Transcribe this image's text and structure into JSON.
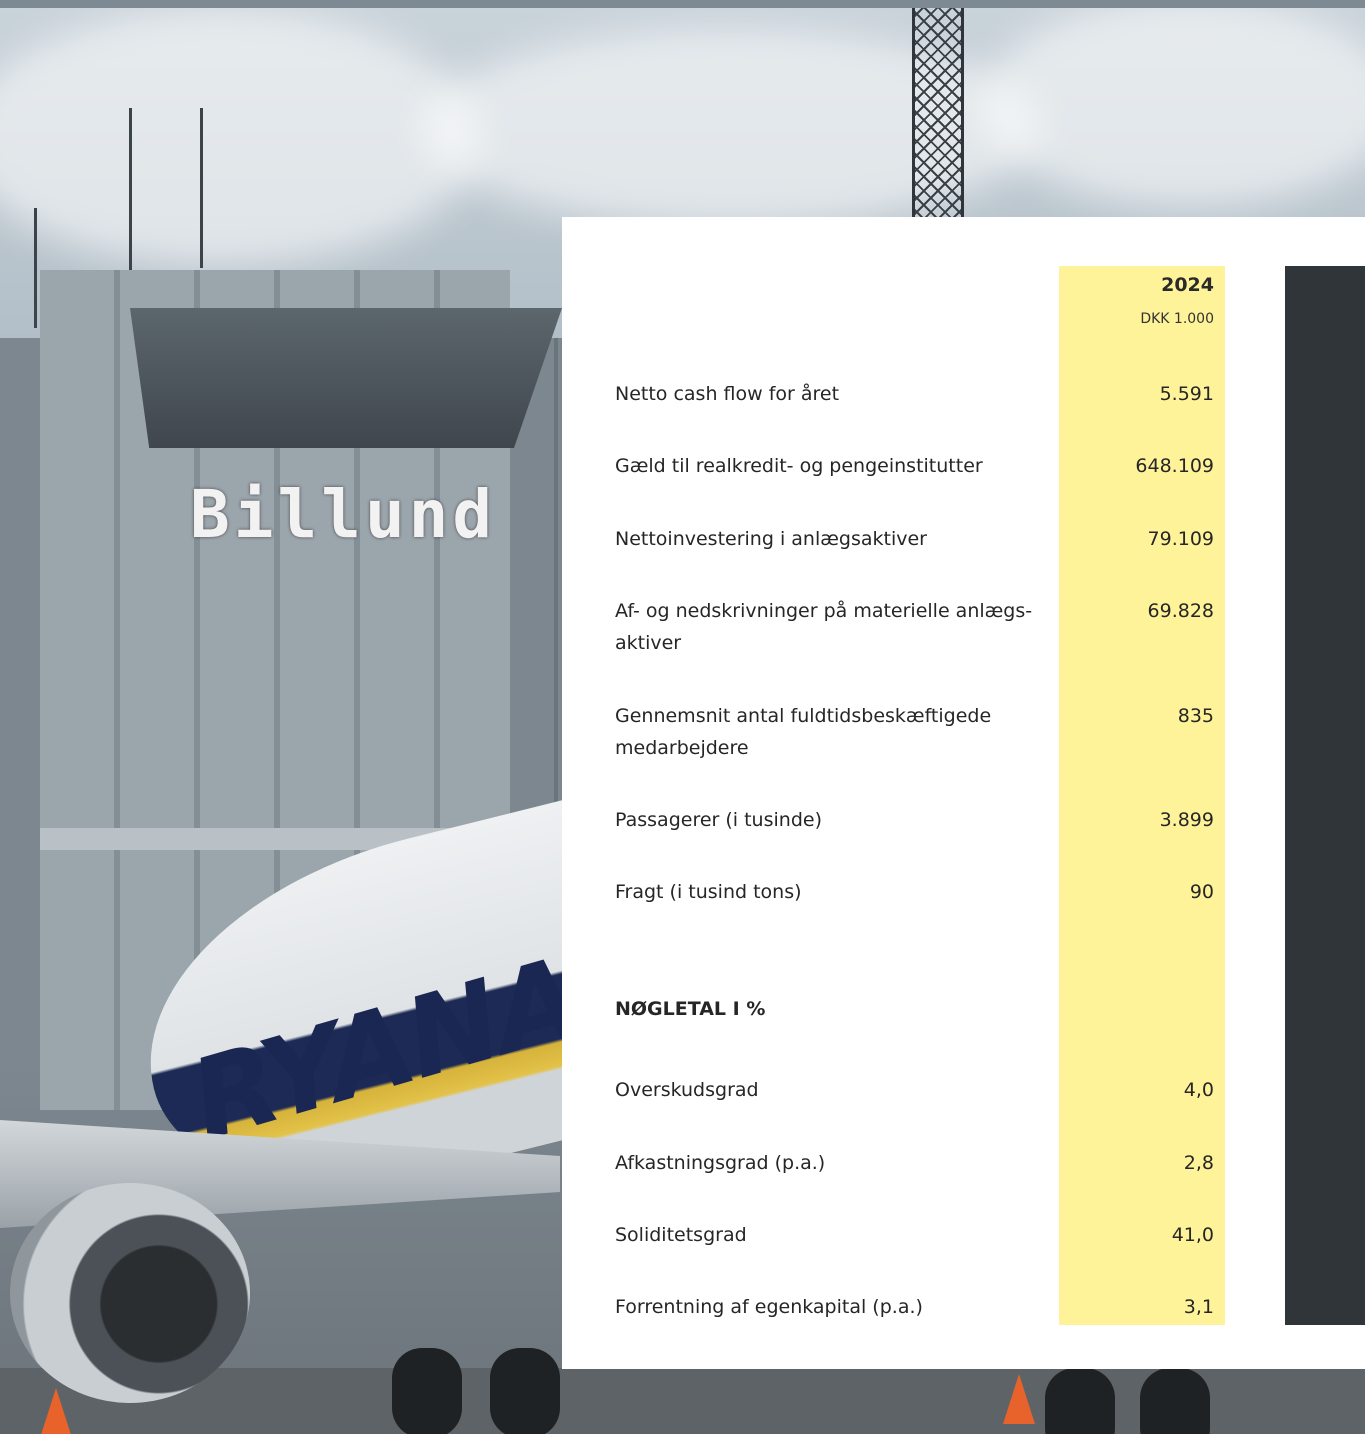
{
  "photo": {
    "sign_text": "Billund",
    "fuselage_text": "RYANAIR"
  },
  "table": {
    "year": "2024",
    "unit": "DKK 1.000",
    "rows": [
      {
        "label": "Netto cash flow for året",
        "value": "5.591"
      },
      {
        "label": "Gæld til realkredit- og pengeinstitutter",
        "value": "648.109"
      },
      {
        "label": "Nettoinvestering i anlægsaktiver",
        "value": "79.109"
      },
      {
        "label": "Af- og nedskrivninger på materielle anlægs-aktiver",
        "value": "69.828"
      },
      {
        "label": "Gennemsnit antal fuldtidsbeskæftigede medarbejdere",
        "value": "835"
      },
      {
        "label": "Passagerer (i tusinde)",
        "value": "3.899"
      },
      {
        "label": "Fragt (i tusind tons)",
        "value": "90"
      }
    ],
    "section_heading": "NØGLETAL I %",
    "ratio_rows": [
      {
        "label": "Overskudsgrad",
        "value": "4,0"
      },
      {
        "label": "Afkastningsgrad (p.a.)",
        "value": "2,8"
      },
      {
        "label": "Soliditetsgrad",
        "value": "41,0"
      },
      {
        "label": "Forrentning af egenkapital (p.a.)",
        "value": "3,1"
      }
    ]
  }
}
